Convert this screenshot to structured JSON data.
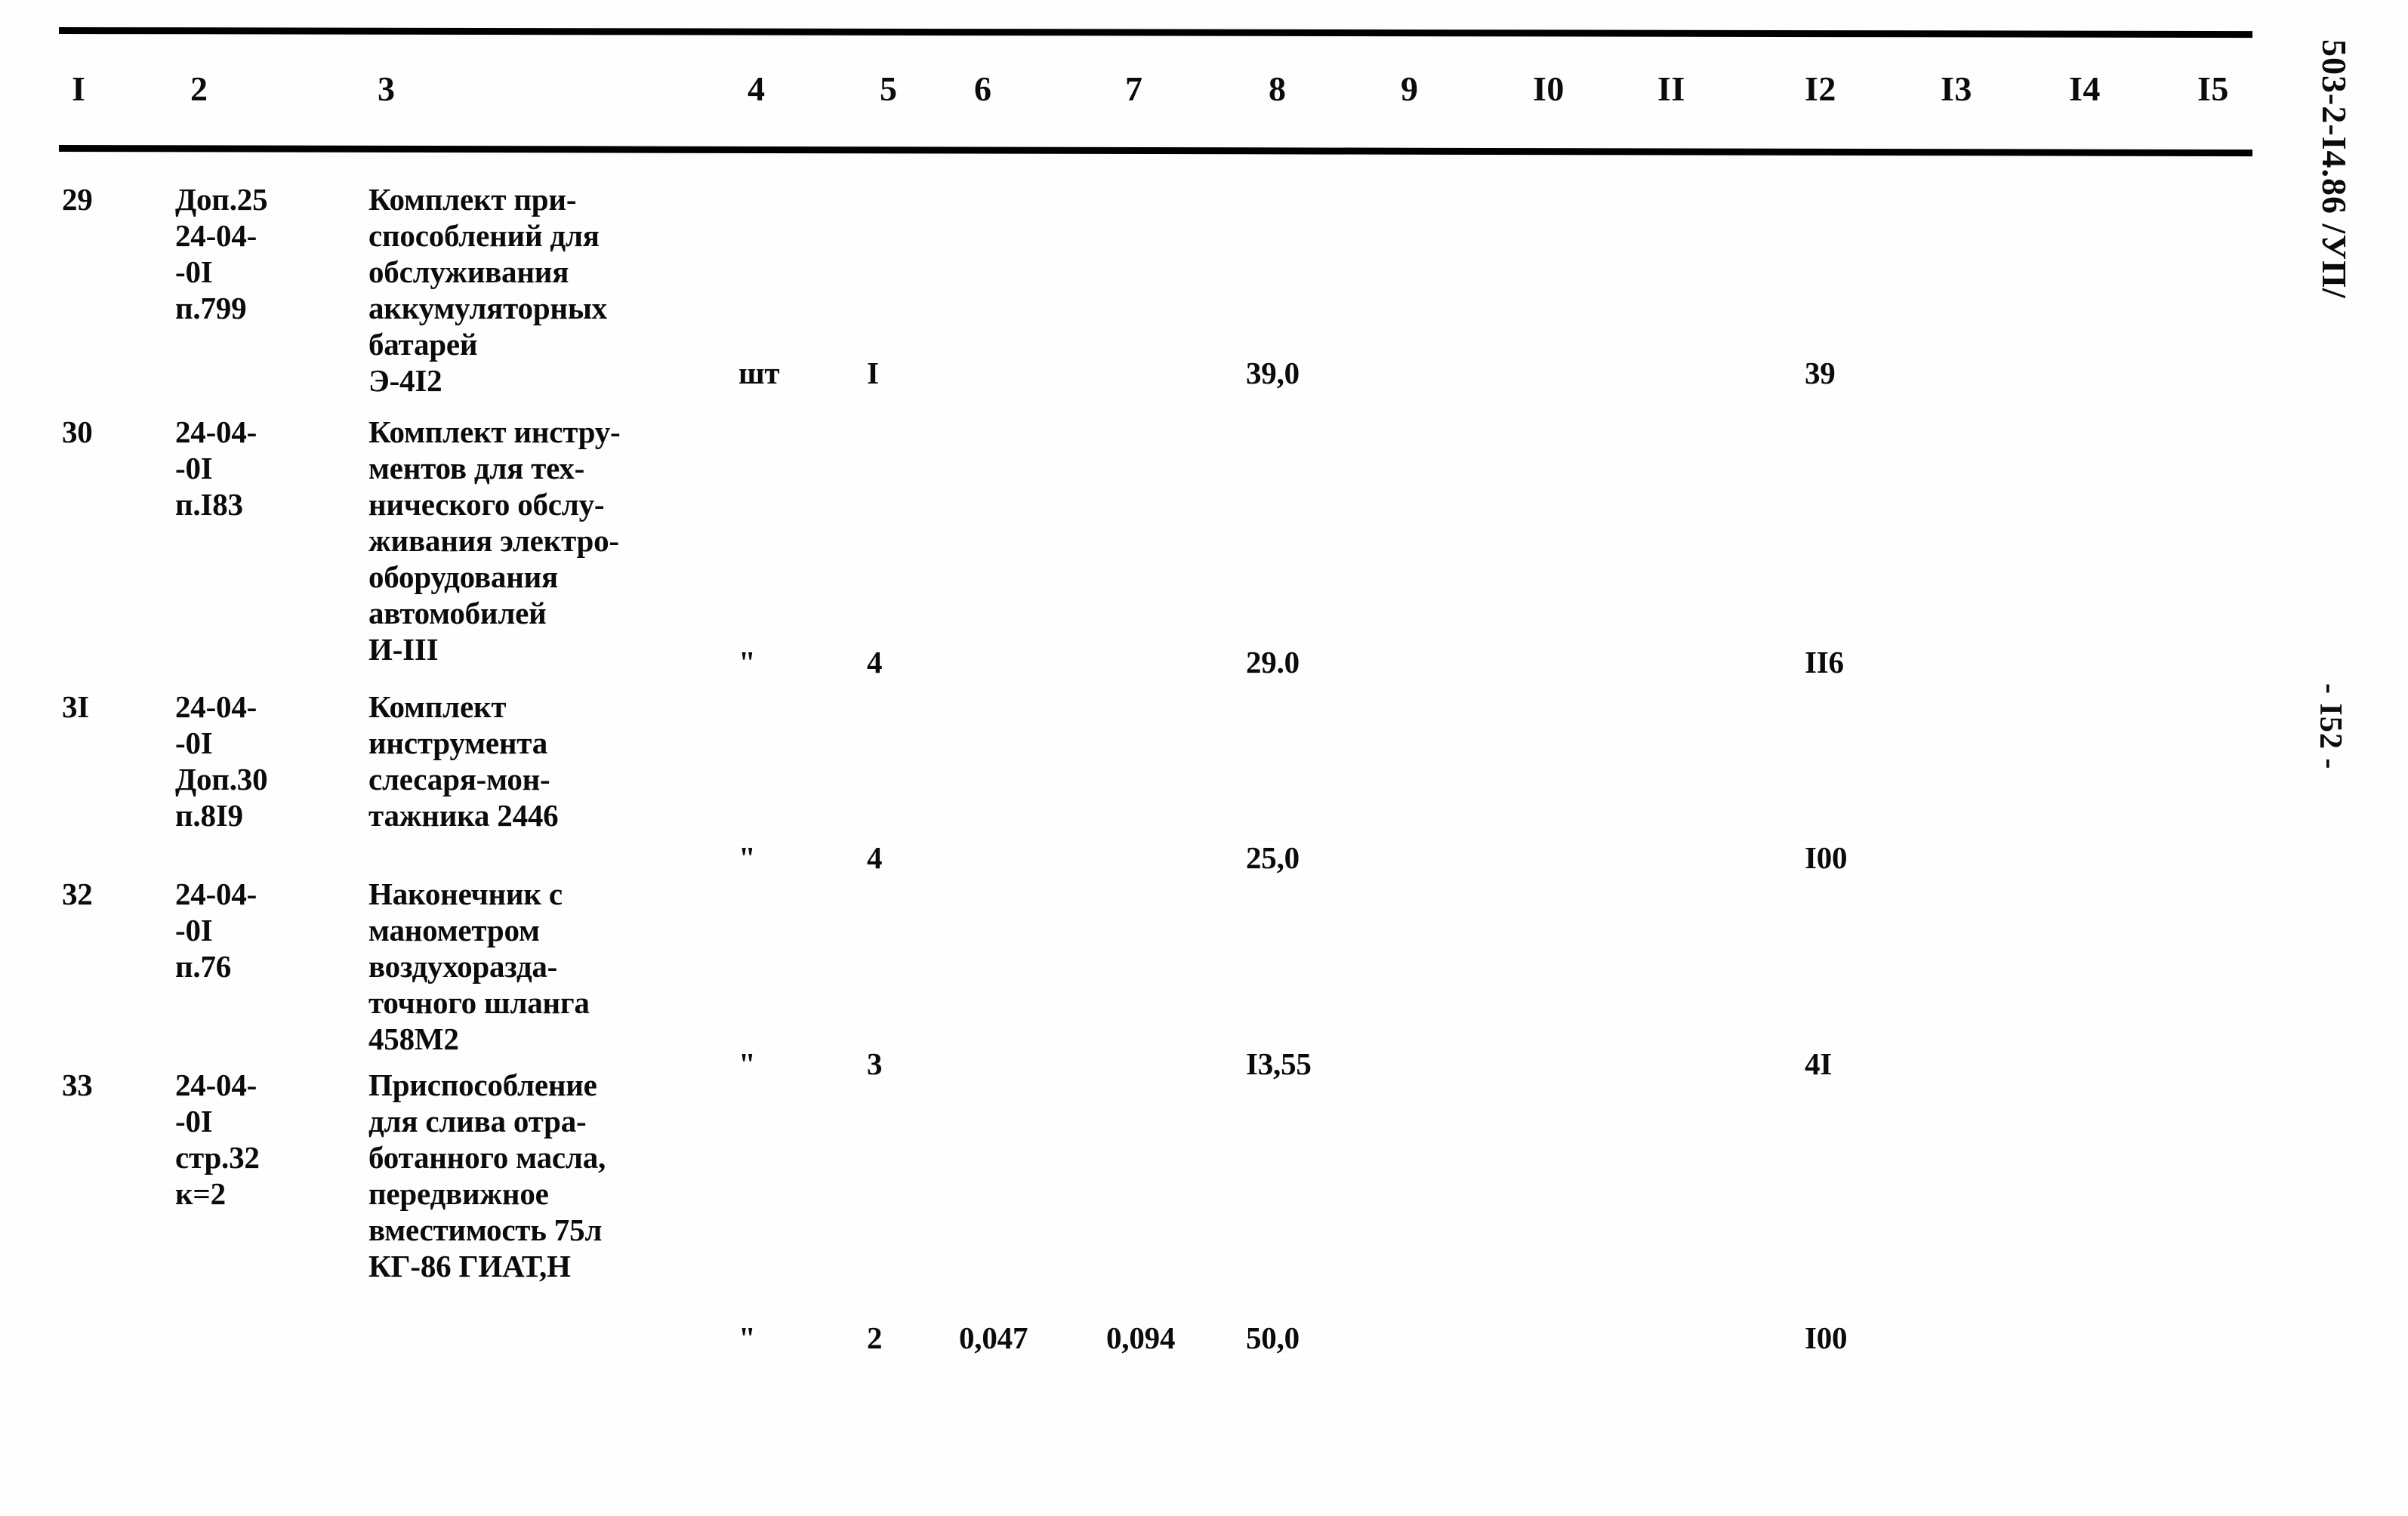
{
  "document": {
    "doc_code": "503-2-I4.86 /УП/",
    "page_number": "- I52 -"
  },
  "table": {
    "column_headers": [
      "I",
      "2",
      "3",
      "4",
      "5",
      "6",
      "7",
      "8",
      "9",
      "I0",
      "II",
      "I2",
      "I3",
      "I4",
      "I5"
    ],
    "rows": [
      {
        "no": "29",
        "code": "Доп.25\n24-04-\n-0I\nп.799",
        "description": "Комплект при-\nспособлений для\nобслуживания\nаккумуляторных\nбатарей\nЭ-4I2",
        "unit": "шт",
        "qty": "I",
        "v6": "",
        "v7": "",
        "v8": "39,0",
        "v12": "39"
      },
      {
        "no": "30",
        "code": "24-04-\n-0I\nп.I83",
        "description": "Комплект инстру-\nментов для тех-\nнического обслу-\nживания электро-\nоборудования\nавтомобилей\nИ-III",
        "unit": "\"",
        "qty": "4",
        "v6": "",
        "v7": "",
        "v8": "29.0",
        "v12": "II6"
      },
      {
        "no": "3I",
        "code": "24-04-\n-0I\nДоп.30\nп.8I9",
        "description": "Комплект\nинструмента\nслесаря-мон-\nтажника 2446",
        "unit": "\"",
        "qty": "4",
        "v6": "",
        "v7": "",
        "v8": "25,0",
        "v12": "I00"
      },
      {
        "no": "32",
        "code": "24-04-\n-0I\nп.76",
        "description": "Наконечник с\nманометром\nвоздухоразда-\nточного шланга\n458М2",
        "unit": "\"",
        "qty": "3",
        "v6": "",
        "v7": "",
        "v8": "I3,55",
        "v12": "4I"
      },
      {
        "no": "33",
        "code": "24-04-\n-0I\nстр.32\nк=2",
        "description": "Приспособление\nдля слива отра-\nботанного масла,\nпередвижное\nвместимость 75л\nКГ-86 ГИАТ,Н",
        "unit": "\"",
        "qty": "2",
        "v6": "0,047",
        "v7": "0,094",
        "v8": "50,0",
        "v12": "I00"
      }
    ]
  },
  "layout": {
    "header_x": [
      95,
      252,
      500,
      990,
      1165,
      1290,
      1490,
      1680,
      1855,
      2030,
      2195,
      2390,
      2570,
      2740,
      2910
    ],
    "row_tops": [
      0,
      308,
      672,
      920,
      1173
    ],
    "numline_tops": [
      230,
      305,
      200,
      225,
      335
    ]
  }
}
